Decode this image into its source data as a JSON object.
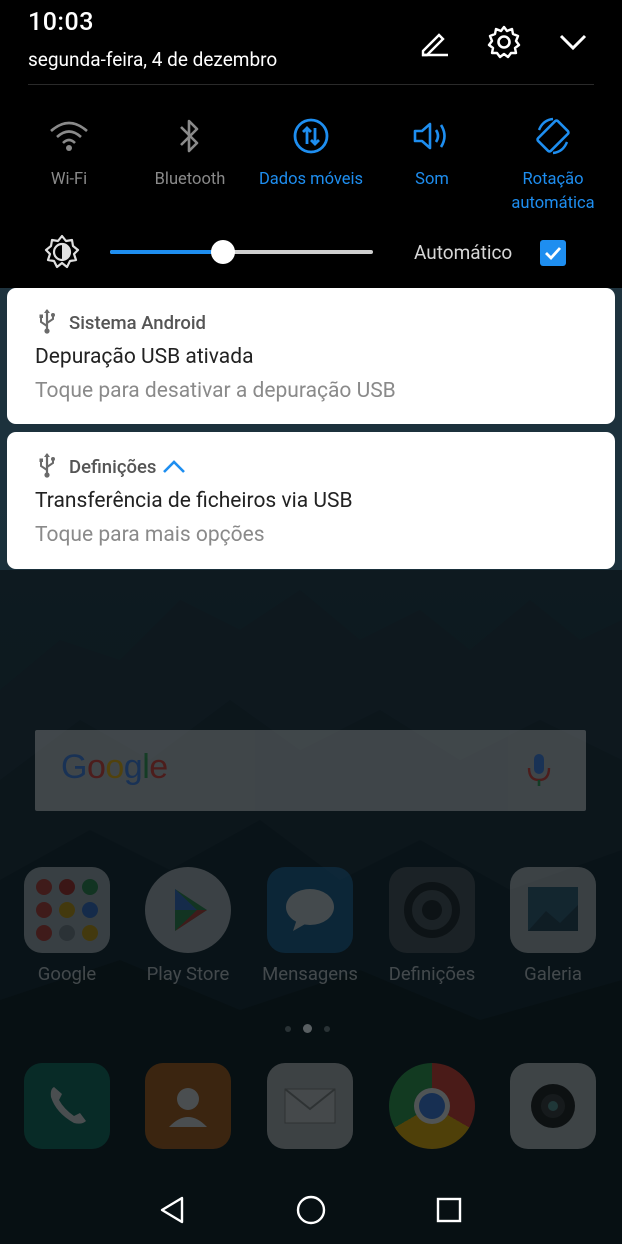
{
  "status": {
    "time": "10:03",
    "date": "segunda-feira, 4 de dezembro"
  },
  "header_icons": [
    {
      "icon": "edit-icon"
    },
    {
      "icon": "settings-gear-icon"
    },
    {
      "icon": "chevron-down-icon"
    }
  ],
  "quick_tiles": [
    {
      "label": "Wi-Fi",
      "icon": "wifi-icon",
      "active": false
    },
    {
      "label": "Bluetooth",
      "icon": "bluetooth-icon",
      "active": false
    },
    {
      "label": "Dados móveis",
      "icon": "mobile-data-icon",
      "active": true
    },
    {
      "label": "Som",
      "icon": "volume-icon",
      "active": true
    },
    {
      "label": "Rotação automática",
      "label_line1": "Rotação",
      "label_line2": "automática",
      "icon": "auto-rotate-icon",
      "active": true
    }
  ],
  "brightness": {
    "level": 0.43,
    "auto_label": "Automático",
    "auto_checked": true
  },
  "notifications": [
    {
      "app": "Sistema Android",
      "title": "Depuração USB ativada",
      "subtitle": "Toque para desativar a depuração USB",
      "icon": "usb-icon"
    },
    {
      "app": "Definições",
      "title": "Transferência de ficheiros via USB",
      "subtitle": "Toque para mais opções",
      "icon": "usb-icon",
      "expanded": true
    }
  ],
  "search": {
    "logo": "Google"
  },
  "apps": [
    {
      "label": "Google",
      "icon": "google-folder-icon"
    },
    {
      "label": "Play Store",
      "icon": "play-store-icon"
    },
    {
      "label": "Mensagens",
      "icon": "messages-icon"
    },
    {
      "label": "Definições",
      "icon": "settings-app-icon"
    },
    {
      "label": "Galeria",
      "icon": "gallery-icon"
    }
  ],
  "dock": [
    {
      "icon": "phone-icon"
    },
    {
      "icon": "contacts-icon"
    },
    {
      "icon": "email-icon"
    },
    {
      "icon": "chrome-icon"
    },
    {
      "icon": "camera-icon"
    }
  ],
  "colors": {
    "accent": "#1e8ef0",
    "shade_bg": "#000000",
    "card_bg": "#ffffff"
  }
}
